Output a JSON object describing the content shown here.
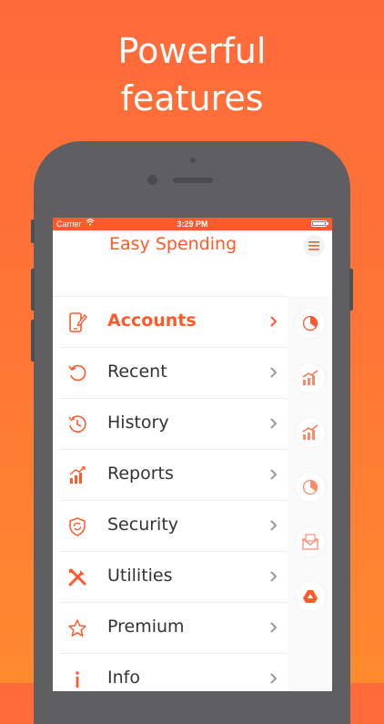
{
  "headline": {
    "line1": "Powerful",
    "line2": "features"
  },
  "status_bar": {
    "carrier": "Carrier",
    "time": "3:29 PM"
  },
  "app": {
    "title": "Easy Spending"
  },
  "menu": [
    {
      "label": "Accounts",
      "icon": "phone-edit-icon",
      "active": true
    },
    {
      "label": "Recent",
      "icon": "refresh-icon",
      "active": false
    },
    {
      "label": "History",
      "icon": "clock-history-icon",
      "active": false
    },
    {
      "label": "Reports",
      "icon": "bar-chart-icon",
      "active": false
    },
    {
      "label": "Security",
      "icon": "shield-sync-icon",
      "active": false
    },
    {
      "label": "Utilities",
      "icon": "tools-icon",
      "active": false
    },
    {
      "label": "Premium",
      "icon": "star-icon",
      "active": false
    },
    {
      "label": "Info",
      "icon": "info-icon",
      "active": false
    }
  ],
  "rail_icons": [
    "pie-chart-icon",
    "growth-chart-icon",
    "growth-chart-icon",
    "pie-chart-icon",
    "mail-icon",
    "drive-icon"
  ],
  "colors": {
    "accent": "#ff5a2c",
    "background": "#ff7436",
    "gray_chevron": "#9a9a9a"
  }
}
